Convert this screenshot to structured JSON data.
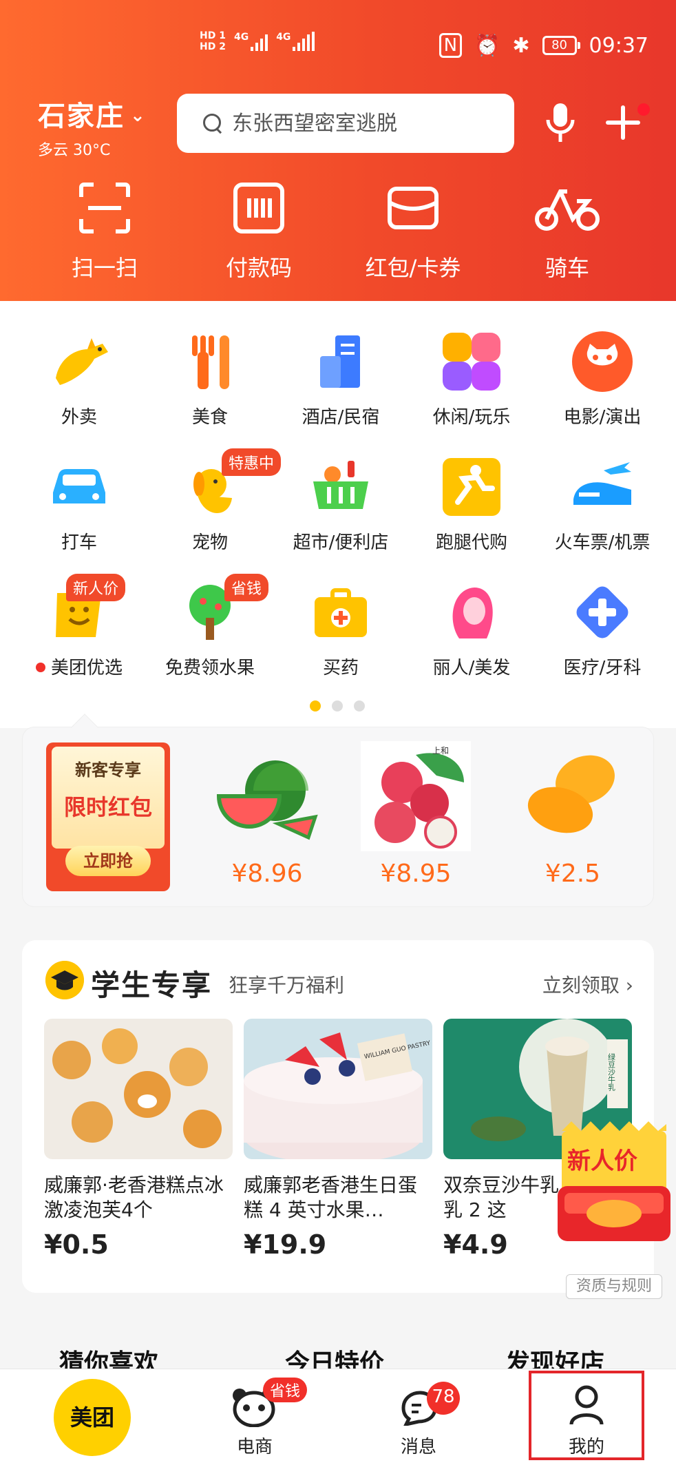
{
  "status_bar": {
    "sim1": "HD 1",
    "sim2": "HD 2",
    "net1": "4G",
    "net2": "4G",
    "battery": "80",
    "time": "09:37"
  },
  "header": {
    "city": "石家庄",
    "weather": "多云 30°C",
    "search_placeholder": "东张西望密室逃脱",
    "quick": [
      {
        "label": "扫一扫",
        "icon": "scan-icon"
      },
      {
        "label": "付款码",
        "icon": "pay-code-icon"
      },
      {
        "label": "红包/卡券",
        "icon": "wallet-icon"
      },
      {
        "label": "骑车",
        "icon": "bike-icon"
      }
    ]
  },
  "categories": [
    {
      "label": "外卖",
      "icon": "kangaroo-icon"
    },
    {
      "label": "美食",
      "icon": "fork-icon"
    },
    {
      "label": "酒店/民宿",
      "icon": "hotel-icon"
    },
    {
      "label": "休闲/玩乐",
      "icon": "leisure-icon"
    },
    {
      "label": "电影/演出",
      "icon": "cat-icon"
    },
    {
      "label": "打车",
      "icon": "car-icon"
    },
    {
      "label": "宠物",
      "icon": "dog-icon",
      "badge": "特惠中"
    },
    {
      "label": "超市/便利店",
      "icon": "basket-icon"
    },
    {
      "label": "跑腿代购",
      "icon": "runner-icon"
    },
    {
      "label": "火车票/机票",
      "icon": "plane-icon"
    },
    {
      "label": "美团优选",
      "icon": "smile-icon",
      "badge": "新人价",
      "dot": true
    },
    {
      "label": "免费领水果",
      "icon": "tree-icon",
      "badge": "省钱"
    },
    {
      "label": "买药",
      "icon": "medkit-icon"
    },
    {
      "label": "丽人/美发",
      "icon": "beauty-icon"
    },
    {
      "label": "医疗/牙科",
      "icon": "medical-cross-icon"
    }
  ],
  "promo": {
    "coupon_title": "新客专享",
    "coupon_main": "限时红包",
    "coupon_button": "立即抢",
    "fruits": [
      {
        "name": "watermelon",
        "price": "¥8.96"
      },
      {
        "name": "lychee",
        "price": "¥8.95",
        "brand": "上和"
      },
      {
        "name": "mango",
        "price": "¥2.5"
      }
    ]
  },
  "student": {
    "title": "学生专享",
    "subtitle": "狂享千万福利",
    "more": "立刻领取",
    "products": [
      {
        "name": "威廉郭·老香港糕点冰激凌泡芙4个",
        "price": "¥0.5"
      },
      {
        "name": "威廉郭老香港生日蛋糕 4 英寸水果…",
        "price": "¥19.9",
        "img_text": "WILLIAM GUO PASTRY 威廉郭"
      },
      {
        "name": "双奈豆沙牛乳 豆沙牛乳 2 这",
        "price": "¥4.9",
        "img_text": "绿豆沙牛乳"
      }
    ]
  },
  "floating": {
    "new_price": "新人价",
    "rules": "资质与规则"
  },
  "bottom_tabs": [
    "猜你喜欢",
    "今日特价",
    "发现好店"
  ],
  "nav": {
    "home": "美团",
    "mall": "电商",
    "mall_badge": "省钱",
    "msg": "消息",
    "msg_badge": "78",
    "mine": "我的"
  },
  "colors": {
    "brand_orange": "#f14a2a",
    "brand_yellow": "#ffc300",
    "price_orange": "#ff6a1a"
  }
}
